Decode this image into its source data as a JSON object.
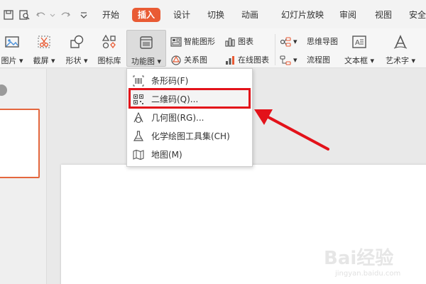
{
  "tabs": [
    {
      "label": "开始",
      "active": false
    },
    {
      "label": "插入",
      "active": true
    },
    {
      "label": "设计",
      "active": false
    },
    {
      "label": "切换",
      "active": false
    },
    {
      "label": "动画",
      "active": false
    },
    {
      "label": "幻灯片放映",
      "active": false
    },
    {
      "label": "审阅",
      "active": false
    },
    {
      "label": "视图",
      "active": false
    },
    {
      "label": "安全",
      "active": false
    }
  ],
  "ribbon": {
    "picture": "图片",
    "screenshot": "截屏",
    "shape": "形状",
    "icon_library": "图标库",
    "function_chart": "功能图",
    "smart_graphic": "智能图形",
    "chart": "图表",
    "relation_chart": "关系图",
    "online_chart": "在线图表",
    "mind_map": "思维导图",
    "flowchart": "流程图",
    "textbox": "文本框",
    "wordart": "艺术字"
  },
  "menu": {
    "items": [
      {
        "label": "条形码(F)",
        "icon": "barcode-icon"
      },
      {
        "label": "二维码(Q)...",
        "icon": "qrcode-icon"
      },
      {
        "label": "几何图(RG)...",
        "icon": "geometry-icon"
      },
      {
        "label": "化学绘图工具集(CH)",
        "icon": "flask-icon"
      },
      {
        "label": "地图(M)",
        "icon": "map-icon"
      }
    ]
  },
  "colors": {
    "accent": "#e95b34",
    "highlight_box": "#e3121a",
    "arrow": "#e3121a"
  },
  "watermark": {
    "logo_text": "Bai经验",
    "url": "jingyan.baidu.com"
  }
}
